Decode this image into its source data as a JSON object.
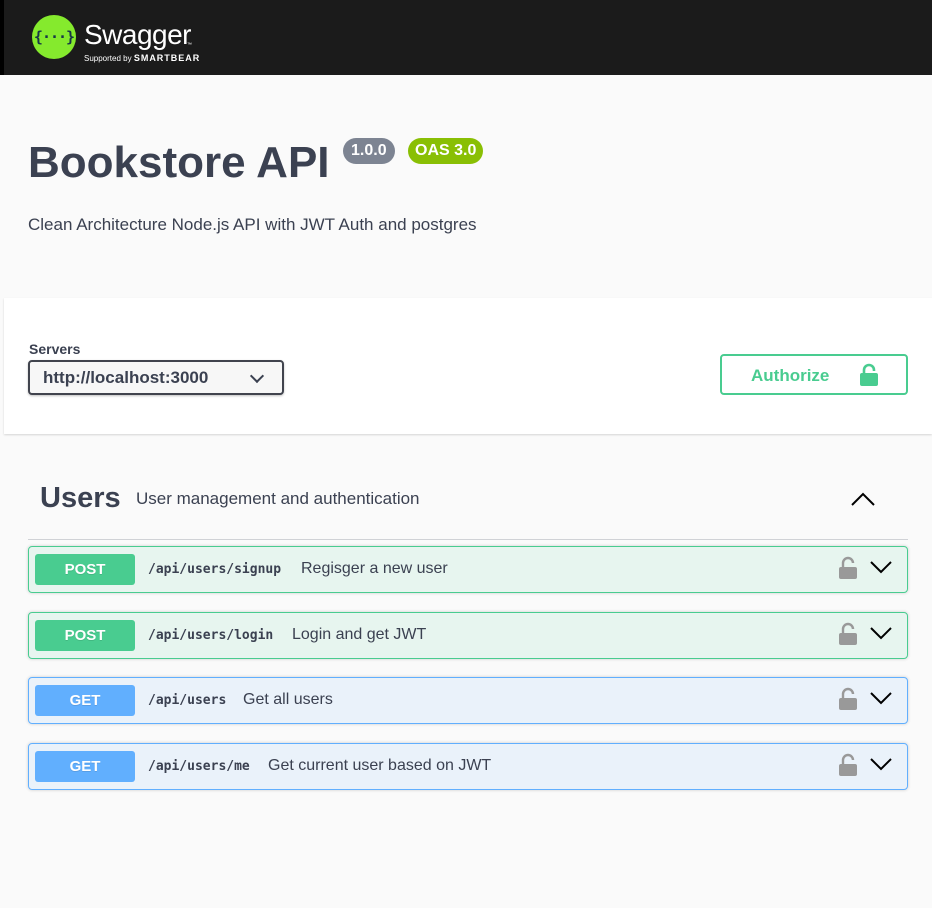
{
  "header": {
    "logo_glyph": "{···}",
    "brand_name": "Swagger",
    "brand_tm": "™",
    "brand_sub_prefix": "Supported by ",
    "brand_sub_company": "SMARTBEAR",
    "bg_color": "#1b1b1b",
    "logo_color": "#85ea2d"
  },
  "info": {
    "title": "Bookstore API",
    "version": "1.0.0",
    "oas_version": "OAS 3.0",
    "description": "Clean Architecture Node.js API with JWT Auth and postgres"
  },
  "servers": {
    "label": "Servers",
    "selected": "http://localhost:3000",
    "options": [
      "http://localhost:3000"
    ]
  },
  "authorize": {
    "label": "Authorize",
    "icon": "lock-icon",
    "color": "#49cc90"
  },
  "tag": {
    "name": "Users",
    "description": "User management and authentication",
    "expanded": true
  },
  "operations": [
    {
      "method": "POST",
      "path": "/api/users/signup",
      "summary": "Regisger a new user",
      "color": "#49cc90"
    },
    {
      "method": "POST",
      "path": "/api/users/login",
      "summary": "Login and get JWT",
      "color": "#49cc90"
    },
    {
      "method": "GET",
      "path": "/api/users",
      "summary": "Get all users",
      "color": "#61affe"
    },
    {
      "method": "GET",
      "path": "/api/users/me",
      "summary": "Get current user based on JWT",
      "color": "#61affe"
    }
  ]
}
